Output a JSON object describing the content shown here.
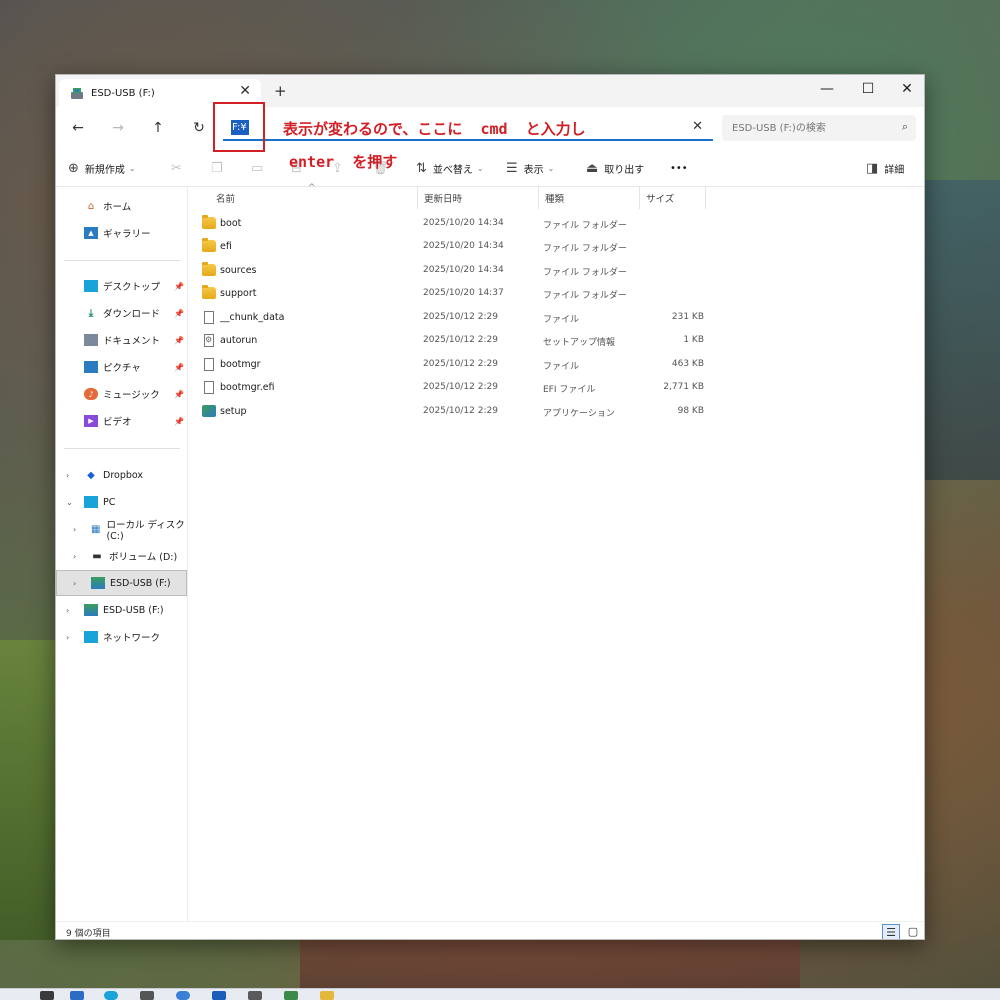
{
  "window": {
    "tab_title": "ESD-USB (F:)",
    "tab_icon": "usb-drive-icon",
    "close_tab": "✕",
    "new_tab": "+",
    "minimize": "—",
    "maximize": "☐",
    "close": "✕"
  },
  "nav": {
    "back": "←",
    "forward": "→",
    "up": "↑",
    "refresh": "↻",
    "address_value": "F:¥",
    "clear": "✕",
    "search_placeholder": "ESD-USB (F:)の検索"
  },
  "toolbar": {
    "new_label": "新規作成",
    "sort_label": "並べ替え",
    "view_label": "表示",
    "eject_label": "取り出す",
    "more_label": "•••",
    "details_label": "詳細"
  },
  "sidebar": {
    "home": "ホーム",
    "gallery": "ギャラリー",
    "desktop": "デスクトップ",
    "downloads": "ダウンロード",
    "documents": "ドキュメント",
    "pictures": "ピクチャ",
    "music": "ミュージック",
    "videos": "ビデオ",
    "dropbox": "Dropbox",
    "pc": "PC",
    "local_disk": "ローカル ディスク (C:)",
    "volume_d": "ボリューム (D:)",
    "esd_usb_under_pc": "ESD-USB (F:)",
    "esd_usb": "ESD-USB (F:)",
    "network": "ネットワーク"
  },
  "columns": {
    "name": "名前",
    "modified": "更新日時",
    "type": "種類",
    "size": "サイズ"
  },
  "files": [
    {
      "name": "boot",
      "date": "2025/10/20 14:34",
      "type": "ファイル フォルダー",
      "size": "",
      "icon": "folder-icon"
    },
    {
      "name": "efi",
      "date": "2025/10/20 14:34",
      "type": "ファイル フォルダー",
      "size": "",
      "icon": "folder-icon"
    },
    {
      "name": "sources",
      "date": "2025/10/20 14:34",
      "type": "ファイル フォルダー",
      "size": "",
      "icon": "folder-icon"
    },
    {
      "name": "support",
      "date": "2025/10/20 14:37",
      "type": "ファイル フォルダー",
      "size": "",
      "icon": "folder-icon"
    },
    {
      "name": "__chunk_data",
      "date": "2025/10/12 2:29",
      "type": "ファイル",
      "size": "231 KB",
      "icon": "file-icon"
    },
    {
      "name": "autorun",
      "date": "2025/10/12 2:29",
      "type": "セットアップ情報",
      "size": "1 KB",
      "icon": "setup-info-icon"
    },
    {
      "name": "bootmgr",
      "date": "2025/10/12 2:29",
      "type": "ファイル",
      "size": "463 KB",
      "icon": "file-icon"
    },
    {
      "name": "bootmgr.efi",
      "date": "2025/10/12 2:29",
      "type": "EFI ファイル",
      "size": "2,771 KB",
      "icon": "file-icon"
    },
    {
      "name": "setup",
      "date": "2025/10/12 2:29",
      "type": "アプリケーション",
      "size": "98 KB",
      "icon": "setup-app-icon"
    }
  ],
  "status": {
    "item_count": "9 個の項目"
  },
  "annotation": {
    "line1": "表示が変わるので、ここに  cmd  と入力し",
    "line2": "enter  を押す",
    "color": "#d21f25"
  }
}
